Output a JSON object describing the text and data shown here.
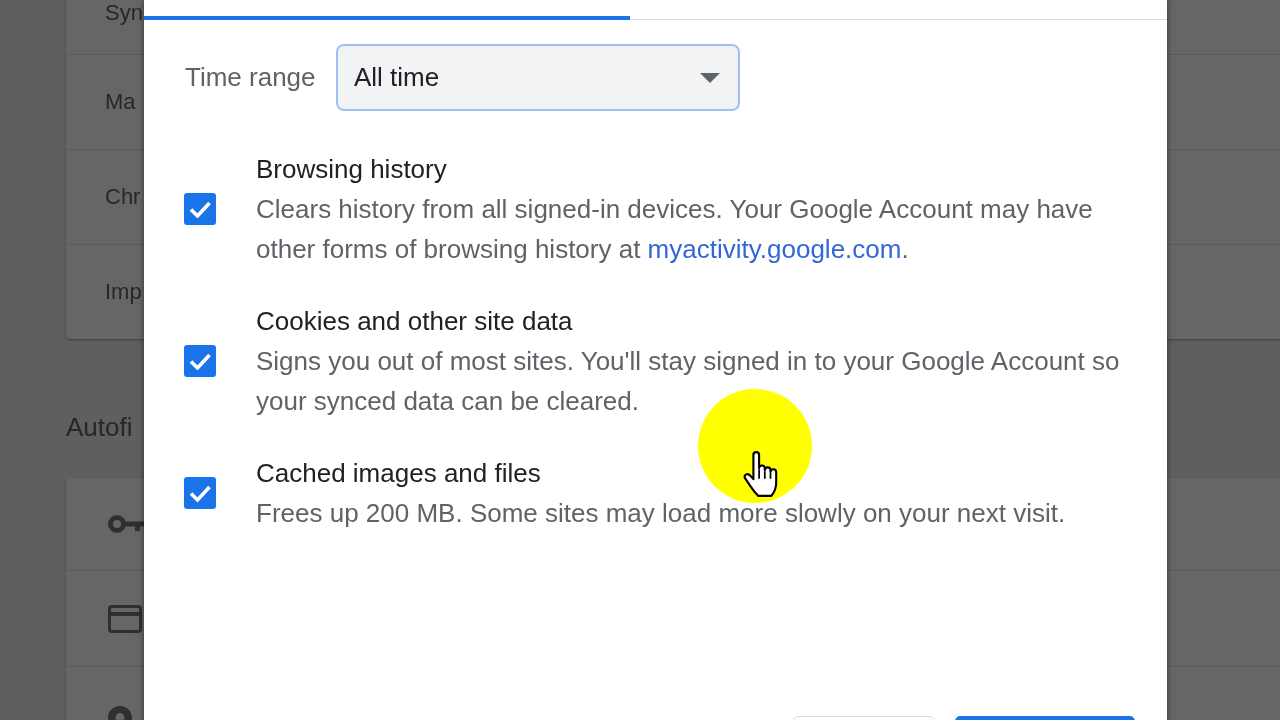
{
  "background": {
    "card_rows": [
      "Syn",
      "Ma",
      "Chr",
      "Imp"
    ],
    "section_title": "Autofi"
  },
  "dialog": {
    "tabs": [
      {
        "selected": true
      },
      {
        "selected": false
      }
    ],
    "time_range": {
      "label": "Time range",
      "value": "All time",
      "focused": true
    },
    "options": [
      {
        "title": "Browsing history",
        "checked": true,
        "description": "Clears history from all signed-in devices. Your Google Account may have other forms of browsing history at ",
        "link": "myactivity.google.com",
        "description_end": "."
      },
      {
        "title": "Cookies and other site data",
        "checked": true,
        "description": "Signs you out of most sites. You'll stay signed in to your Google Account so your synced data can be cleared."
      },
      {
        "title": "Cached images and files",
        "checked": true,
        "description": "Frees up 200 MB. Some sites may load more slowly on your next visit."
      }
    ],
    "buttons": [
      {
        "kind": "outlined"
      },
      {
        "kind": "filled"
      }
    ]
  }
}
